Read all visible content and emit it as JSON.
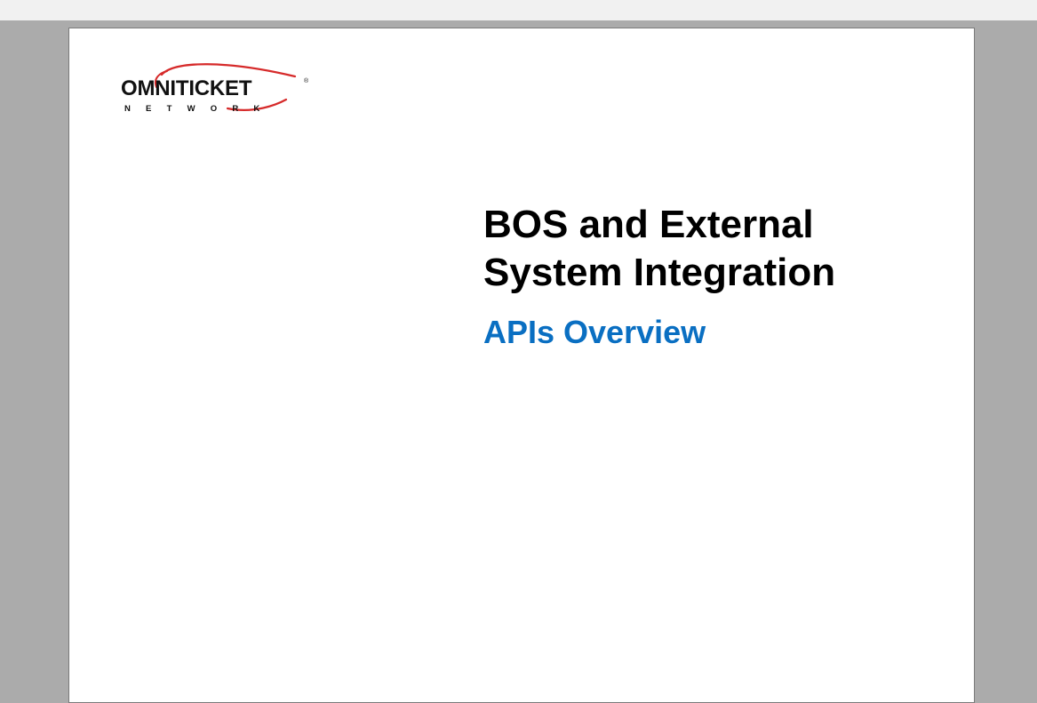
{
  "document": {
    "logo": {
      "wordmark": "OMNITICKET",
      "registered_mark": "®",
      "subline": "NETWORK",
      "swoosh_color": "#d62a2a"
    },
    "title_line_1": "BOS and External",
    "title_line_2": "System Integration",
    "subtitle": "APIs Overview",
    "subtitle_color": "#0a6fc2"
  }
}
